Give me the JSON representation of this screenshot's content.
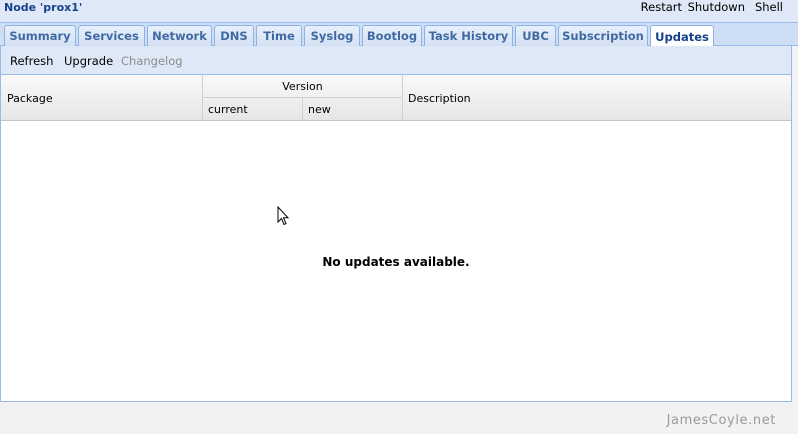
{
  "header": {
    "node_title": "Node 'prox1'",
    "actions": {
      "restart": "Restart",
      "shutdown": "Shutdown",
      "shell": "Shell"
    }
  },
  "tabs": [
    {
      "label": "Summary",
      "active": false
    },
    {
      "label": "Services",
      "active": false
    },
    {
      "label": "Network",
      "active": false
    },
    {
      "label": "DNS",
      "active": false
    },
    {
      "label": "Time",
      "active": false
    },
    {
      "label": "Syslog",
      "active": false
    },
    {
      "label": "Bootlog",
      "active": false
    },
    {
      "label": "Task History",
      "active": false
    },
    {
      "label": "UBC",
      "active": false
    },
    {
      "label": "Subscription",
      "active": false
    },
    {
      "label": "Updates",
      "active": true
    }
  ],
  "toolbar": {
    "refresh": "Refresh",
    "upgrade": "Upgrade",
    "changelog": "Changelog"
  },
  "grid": {
    "columns": {
      "package": "Package",
      "version": "Version",
      "current": "current",
      "new": "new",
      "description": "Description"
    },
    "empty_text": "No updates available."
  },
  "footer": {
    "watermark": "JamesCoyle.net"
  },
  "colors": {
    "accent": "#15428b",
    "tab_text": "#416aa3",
    "border": "#99bbe8",
    "toolbar_bg": "#dfe8f6"
  }
}
